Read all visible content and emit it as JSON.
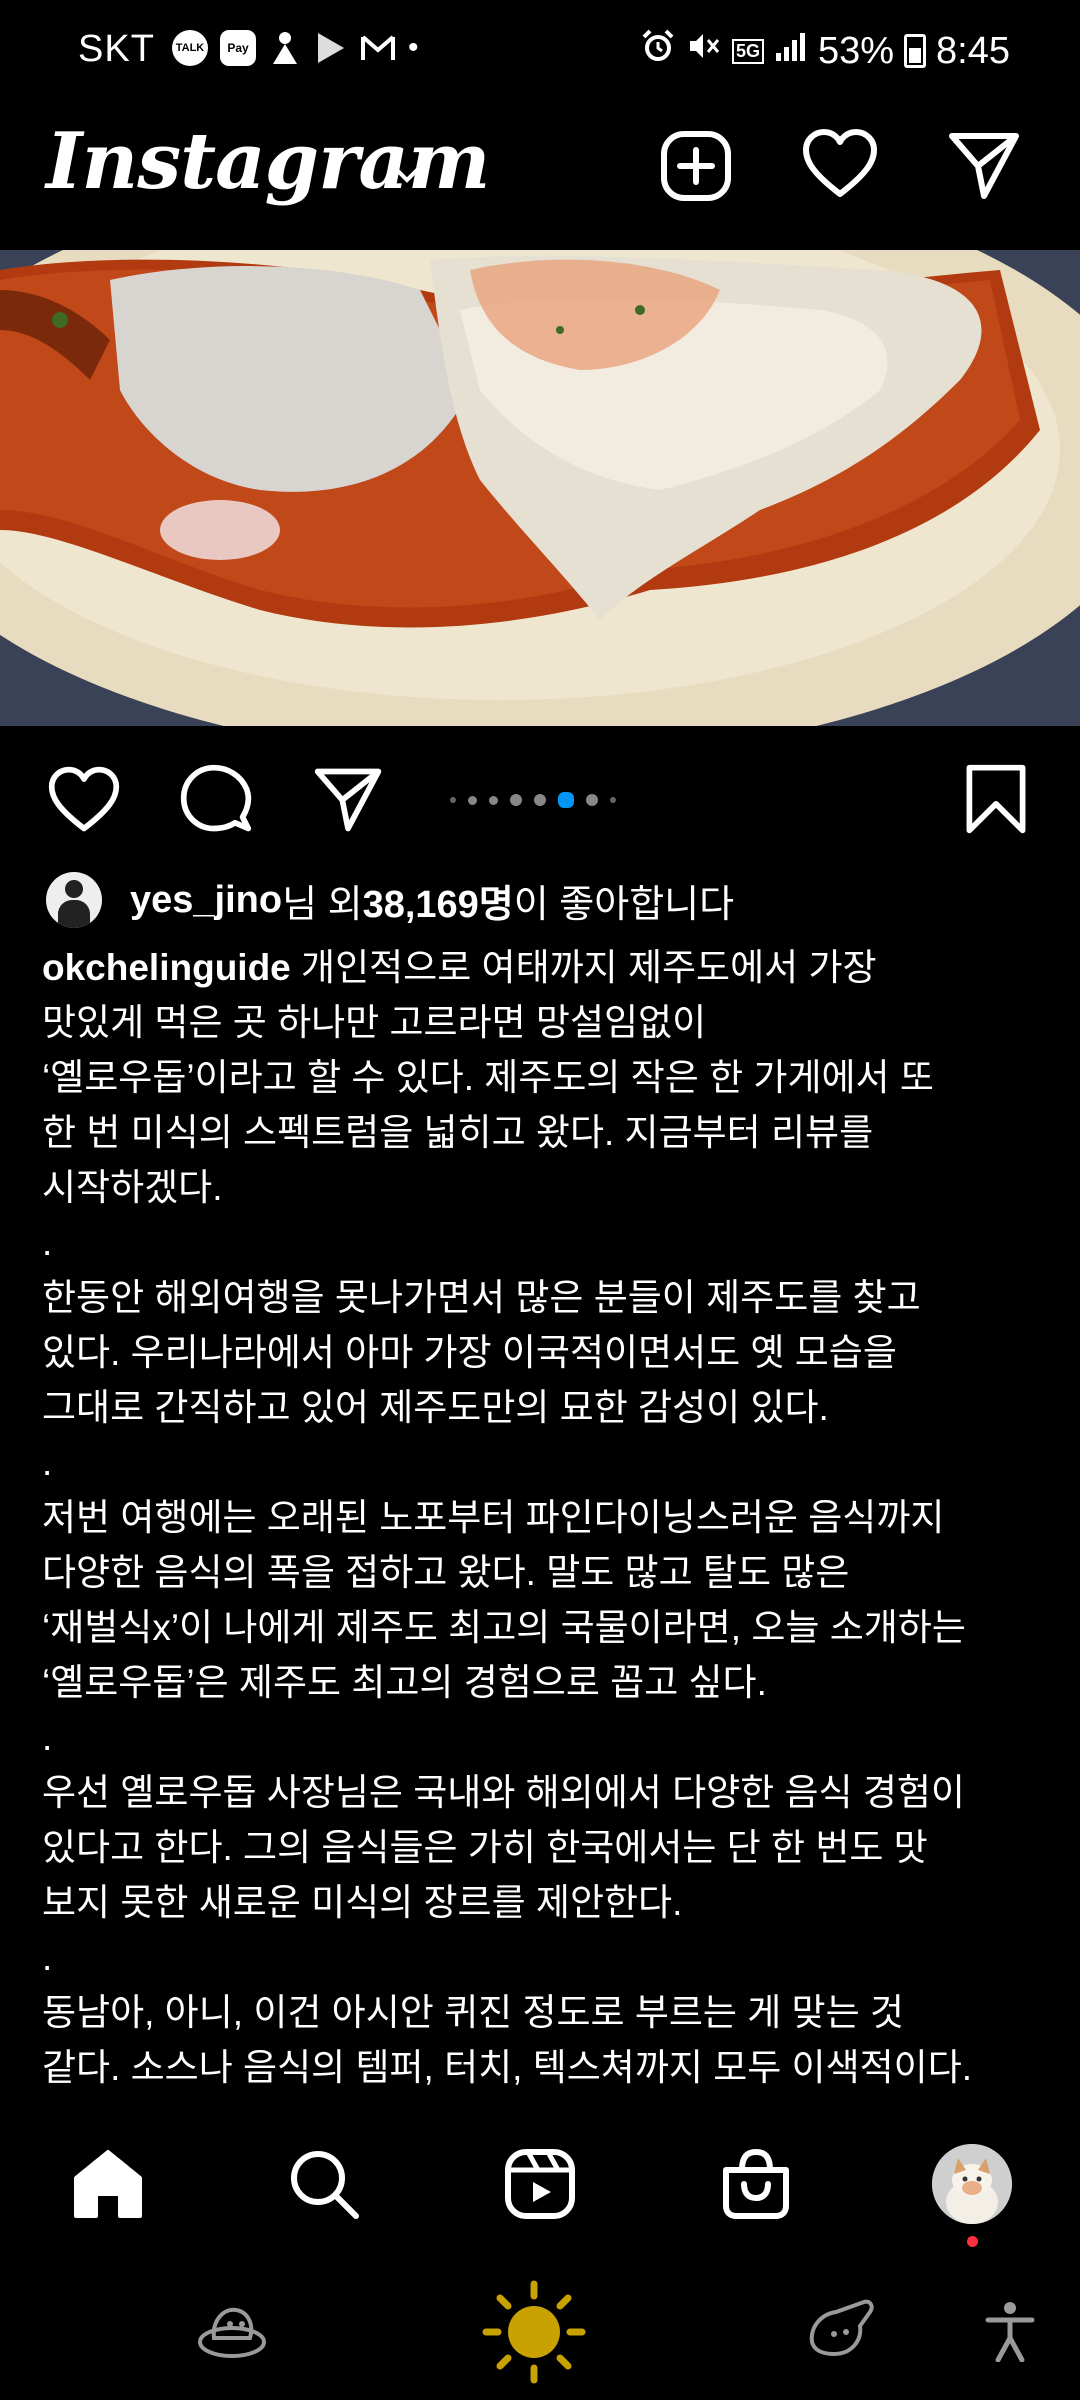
{
  "status_bar": {
    "carrier": "SKT",
    "talk_label": "TALK",
    "pay_label": "Pay",
    "more_dot": "•",
    "network": "5G",
    "battery": "53%",
    "time": "8:45"
  },
  "header": {
    "brand": "Instagram"
  },
  "post": {
    "carousel": {
      "count": 8,
      "active_index": 5
    },
    "likes": {
      "user": "yes_jino",
      "text_mid": "님 외 ",
      "count": "38,169명",
      "text_end": "이 좋아합니다"
    },
    "caption": {
      "username": "okchelinguide",
      "text": " 개인적으로 여태까지 제주도에서 가장\n맛있게 먹은 곳 하나만 고르라면 망설임없이\n‘옐로우돕’이라고 할 수 있다. 제주도의 작은 한 가게에서 또\n한 번 미식의 스펙트럼을 넓히고 왔다. 지금부터 리뷰를\n시작하겠다.\n.\n한동안 해외여행을 못나가면서 많은 분들이 제주도를 찾고\n있다. 우리나라에서 아마 가장 이국적이면서도 옛 모습을\n그대로 간직하고 있어 제주도만의 묘한 감성이 있다.\n.\n저번 여행에는 오래된 노포부터 파인다이닝스러운 음식까지\n다양한 음식의 폭을 접하고 왔다. 말도 많고 탈도 많은\n‘재벌식x’이 나에게 제주도 최고의 국물이라면, 오늘 소개하는\n‘옐로우돕’은 제주도 최고의 경험으로 꼽고 싶다.\n.\n우선 옐로우돕 사장님은 국내와 해외에서 다양한 음식 경험이\n있다고 한다. 그의 음식들은 가히 한국에서는 단 한 번도 맛\n보지 못한 새로운 미식의 장르를 제안한다.\n.\n동남아, 아니, 이건 아시안 퀴진 정도로 부르는 게 맞는 것\n같다. 소스나 음식의 템퍼, 터치, 텍스쳐까지 모두 이색적이다."
    }
  },
  "colors": {
    "background": "#000000",
    "text": "#ffffff",
    "carousel_active": "#0095f6",
    "notification": "#ff3040",
    "sun": "#c8a200"
  },
  "icons": {
    "header": [
      "new-post-icon",
      "heart-icon",
      "direct-message-icon"
    ],
    "actions": [
      "like-icon",
      "comment-icon",
      "share-icon",
      "bookmark-icon"
    ],
    "nav": [
      "home-icon",
      "search-icon",
      "reels-icon",
      "shop-icon",
      "profile-avatar"
    ],
    "system": [
      "game-launcher-icon",
      "sun-icon",
      "game-booster-icon",
      "accessibility-icon"
    ]
  }
}
